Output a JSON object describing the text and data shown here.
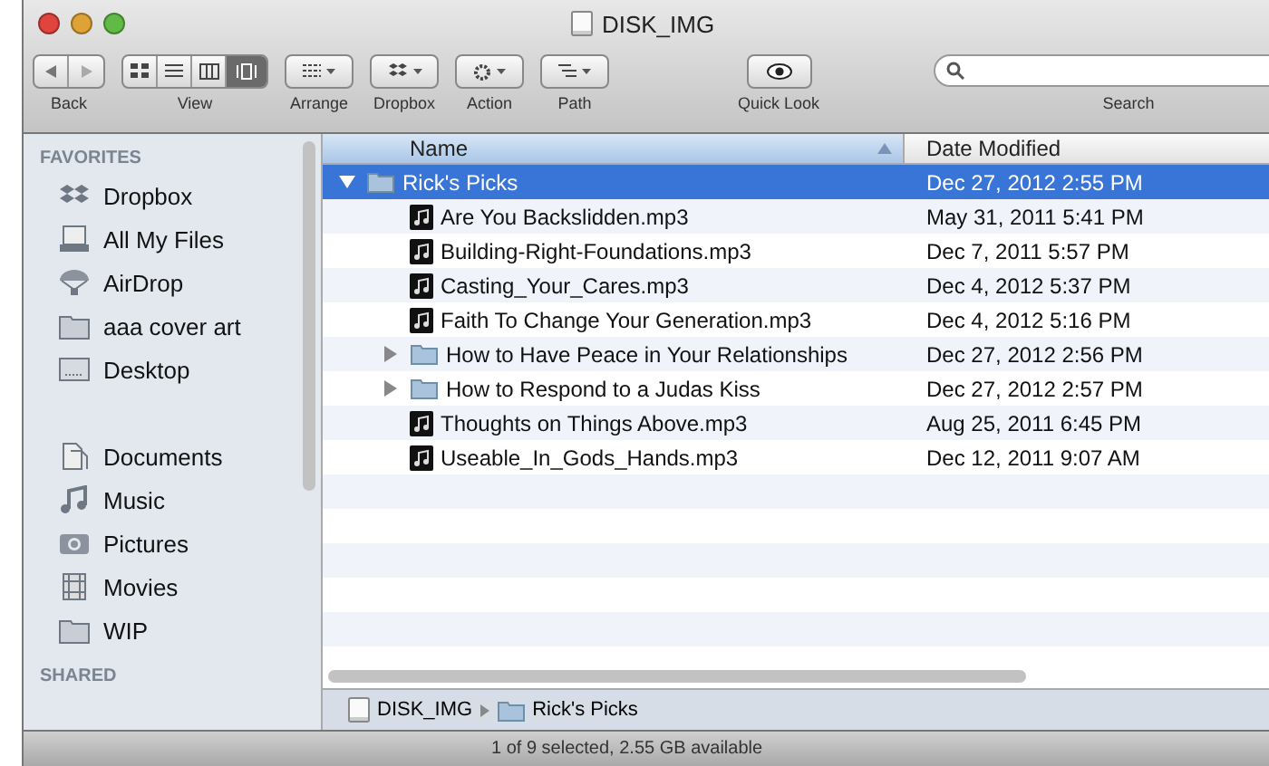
{
  "window": {
    "title": "DISK_IMG"
  },
  "toolbar": [
    {
      "kind": "nav",
      "label": "Back"
    },
    {
      "kind": "view",
      "label": "View"
    },
    {
      "kind": "arrange",
      "label": "Arrange"
    },
    {
      "kind": "dropbox",
      "label": "Dropbox"
    },
    {
      "kind": "action",
      "label": "Action"
    },
    {
      "kind": "path",
      "label": "Path"
    },
    {
      "kind": "quicklook",
      "label": "Quick Look"
    }
  ],
  "search": {
    "label": "Search"
  },
  "sidebar": {
    "sections": [
      {
        "title": "FAVORITES",
        "items": [
          {
            "kind": "dropbox",
            "label": "Dropbox"
          },
          {
            "kind": "files",
            "label": "All My Files"
          },
          {
            "kind": "airdrop",
            "label": "AirDrop"
          },
          {
            "kind": "folder",
            "label": "aaa cover art"
          },
          {
            "kind": "desktop",
            "label": "Desktop"
          },
          {
            "kind": "gap"
          },
          {
            "kind": "documents",
            "label": "Documents"
          },
          {
            "kind": "music",
            "label": "Music"
          },
          {
            "kind": "pictures",
            "label": "Pictures"
          },
          {
            "kind": "movies",
            "label": "Movies"
          },
          {
            "kind": "folder",
            "label": "WIP"
          }
        ]
      },
      {
        "title": "SHARED"
      }
    ]
  },
  "table": {
    "columns": [
      "Name",
      "Date Modified"
    ],
    "rows": [
      {
        "kind": "folder",
        "name": "Rick's Picks",
        "date": "Dec 27, 2012 2:55 PM",
        "selected": true,
        "expanded": true,
        "children": [
          {
            "kind": "audio",
            "name": "Are You Backslidden.mp3",
            "date": "May 31, 2011 5:41 PM",
            "selected": false
          },
          {
            "kind": "audio",
            "name": "Building-Right-Foundations.mp3",
            "date": "Dec 7, 2011 5:57 PM",
            "selected": false
          },
          {
            "kind": "audio",
            "name": "Casting_Your_Cares.mp3",
            "date": "Dec 4, 2012 5:37 PM",
            "selected": false
          },
          {
            "kind": "audio",
            "name": "Faith To Change Your Generation.mp3",
            "date": "Dec 4, 2012 5:16 PM",
            "selected": false
          },
          {
            "kind": "folder",
            "name": "How to Have Peace in Your Relationships",
            "date": "Dec 27, 2012 2:56 PM",
            "selected": false,
            "expanded": false
          },
          {
            "kind": "folder",
            "name": "How to Respond to a Judas Kiss",
            "date": "Dec 27, 2012 2:57 PM",
            "selected": false,
            "expanded": false
          },
          {
            "kind": "audio",
            "name": "Thoughts on Things Above.mp3",
            "date": "Aug 25, 2011 6:45 PM",
            "selected": false
          },
          {
            "kind": "audio",
            "name": "Useable_In_Gods_Hands.mp3",
            "date": "Dec 12, 2011 9:07 AM",
            "selected": false
          }
        ]
      }
    ]
  },
  "path_bar": [
    {
      "kind": "disk",
      "label": "DISK_IMG"
    },
    {
      "kind": "folder",
      "label": "Rick's Picks"
    }
  ],
  "status_bar": "1 of 9 selected, 2.55 GB available"
}
